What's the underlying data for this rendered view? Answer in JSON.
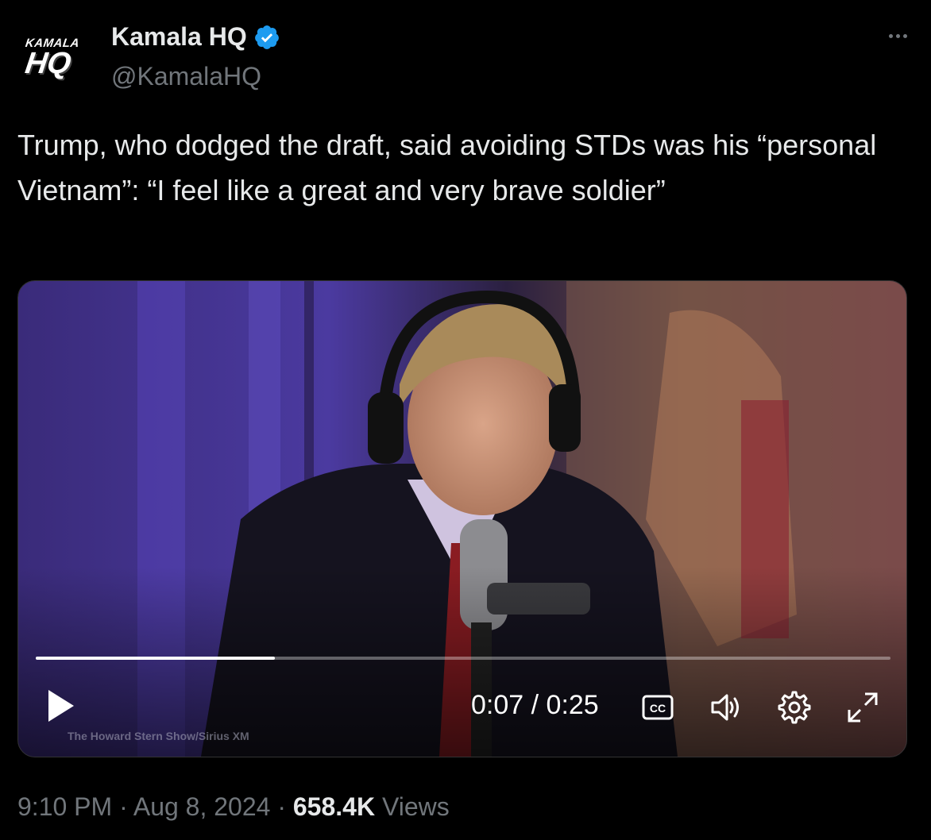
{
  "account": {
    "logo_top": "KAMALA",
    "logo_bottom": "HQ",
    "display_name": "Kamala HQ",
    "handle": "@KamalaHQ",
    "verified": true,
    "verified_color": "#1d9bf0"
  },
  "more_icon": "more-horizontal-icon",
  "tweet": {
    "text": "Trump, who dodged the draft, said avoiding STDs was his “personal Vietnam”: “I feel like a great and very brave soldier”"
  },
  "video": {
    "progress": 0.28,
    "current_time": "0:07",
    "separator": "/",
    "duration": "0:25",
    "watermark": "The Howard Stern Show/Sirius XM",
    "controls": {
      "play": "play-icon",
      "captions": "closed-captions-icon",
      "volume": "volume-icon",
      "settings": "gear-icon",
      "fullscreen": "fullscreen-icon"
    }
  },
  "footer": {
    "time": "9:10 PM",
    "date": "Aug 8, 2024",
    "views_count": "658.4K",
    "views_label": "Views"
  }
}
